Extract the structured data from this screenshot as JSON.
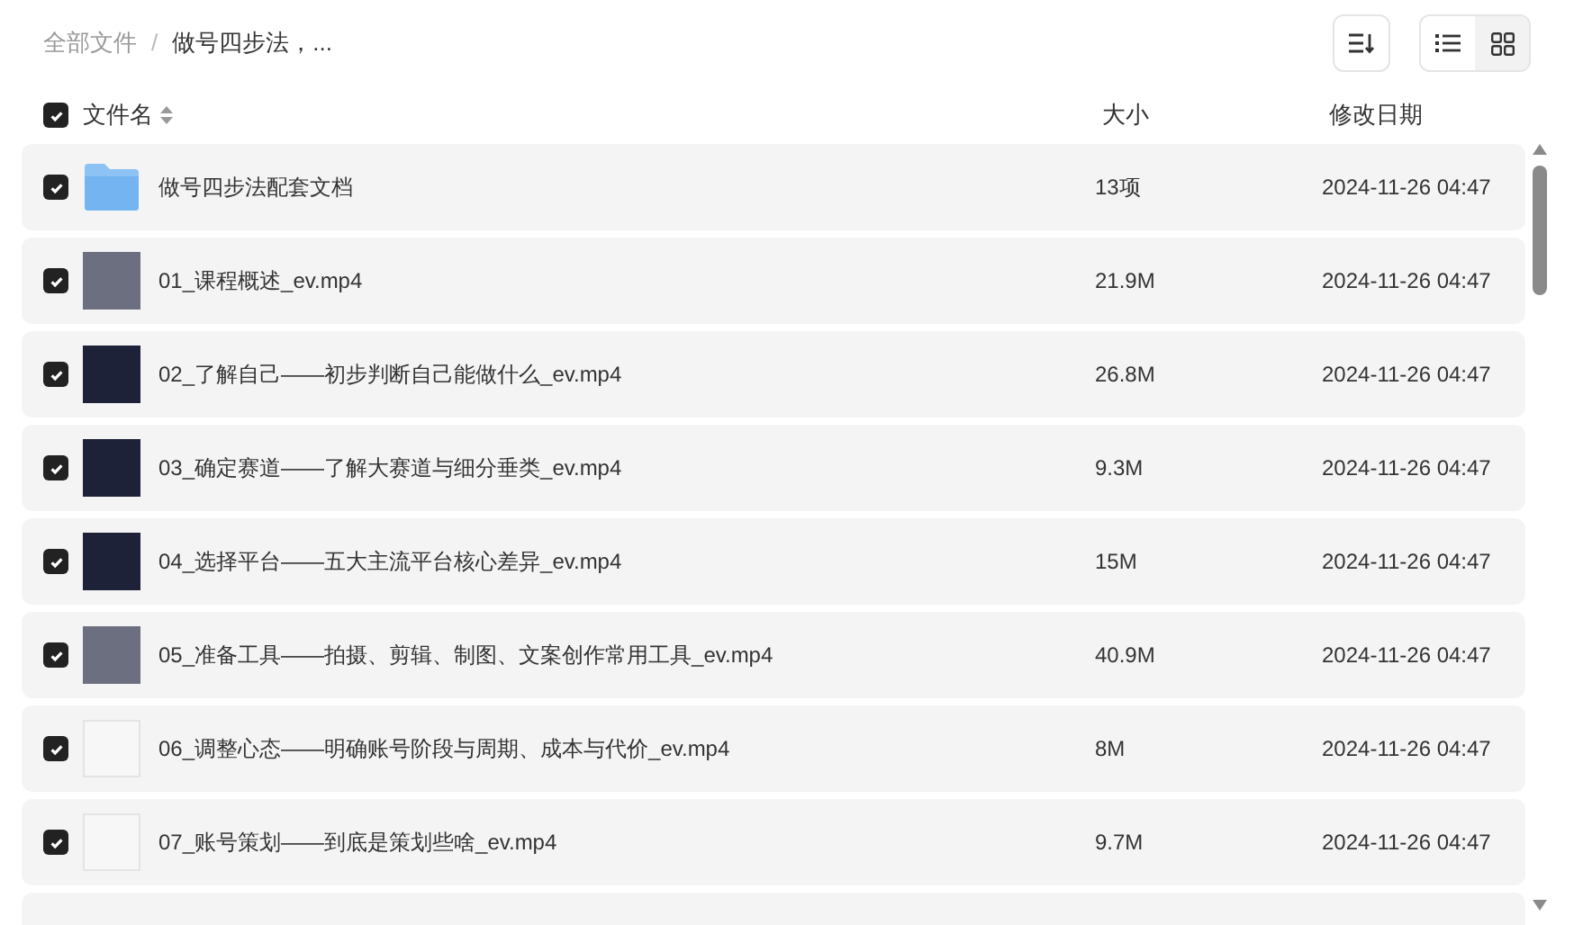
{
  "breadcrumb": [
    {
      "label": "全部文件",
      "current": false,
      "separator": "/"
    },
    {
      "label": "做号四步法，...",
      "current": true
    }
  ],
  "view_toggle": [
    {
      "kind": "list",
      "selected": false
    },
    {
      "kind": "grid",
      "selected": true
    }
  ],
  "header": {
    "checked": true,
    "name": "文件名",
    "size": "大小",
    "date": "修改日期"
  },
  "rows": [
    {
      "kind": "folder",
      "checked": true,
      "name": "做号四步法配套文档",
      "size": "13项",
      "date": "2024-11-26 04:47"
    },
    {
      "kind": "photo",
      "checked": true,
      "name": "01_课程概述_ev.mp4",
      "size": "21.9M",
      "date": "2024-11-26 04:47"
    },
    {
      "kind": "cover",
      "checked": true,
      "name": "02_了解自己——初步判断自己能做什么_ev.mp4",
      "size": "26.8M",
      "date": "2024-11-26 04:47"
    },
    {
      "kind": "cover",
      "checked": true,
      "name": "03_确定赛道——了解大赛道与细分垂类_ev.mp4",
      "size": "9.3M",
      "date": "2024-11-26 04:47"
    },
    {
      "kind": "cover",
      "checked": true,
      "name": "04_选择平台——五大主流平台核心差异_ev.mp4",
      "size": "15M",
      "date": "2024-11-26 04:47"
    },
    {
      "kind": "photo",
      "checked": true,
      "name": "05_准备工具——拍摄、剪辑、制图、文案创作常用工具_ev.mp4",
      "size": "40.9M",
      "date": "2024-11-26 04:47"
    },
    {
      "kind": "document",
      "checked": true,
      "name": "06_调整心态——明确账号阶段与周期、成本与代价_ev.mp4",
      "size": "8M",
      "date": "2024-11-26 04:47"
    },
    {
      "kind": "document",
      "checked": true,
      "name": "07_账号策划——到底是策划些啥_ev.mp4",
      "size": "9.7M",
      "date": "2024-11-26 04:47"
    }
  ]
}
